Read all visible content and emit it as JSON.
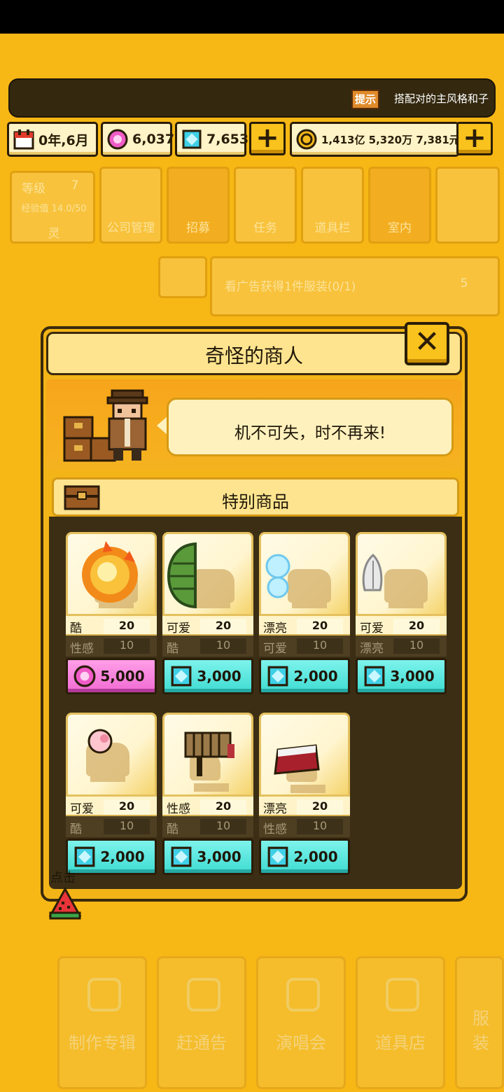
{
  "hint": {
    "badge": "提示",
    "text": "搭配对的主风格和子"
  },
  "resources": {
    "date": "0年,6月",
    "pink_gems": "6,037",
    "blue_gems": "7,653",
    "money": "1,413亿 5,320万 7,381元"
  },
  "background": {
    "level_label": "等级",
    "level_value": "7",
    "exp_label": "经验值 14.0/50",
    "char_name": "灵",
    "menu": [
      "公司管理",
      "招募",
      "任务",
      "道具栏",
      "室内"
    ],
    "ad_text": "看广告获得1件服装(0/1)",
    "ad_reward": "5",
    "bottom_nav": [
      "制作专辑",
      "赶通告",
      "演唱会",
      "道具店",
      "服装"
    ]
  },
  "dialog": {
    "title": "奇怪的商人",
    "close_label": "✕",
    "speech": "机不可失，时不再来!",
    "section_title": "特别商品",
    "items": [
      {
        "stat1_name": "酷",
        "stat1_val": "20",
        "stat2_name": "性感",
        "stat2_val": "10",
        "price": "5,000",
        "currency": "pink"
      },
      {
        "stat1_name": "可爱",
        "stat1_val": "20",
        "stat2_name": "酷",
        "stat2_val": "10",
        "price": "3,000",
        "currency": "blue"
      },
      {
        "stat1_name": "漂亮",
        "stat1_val": "20",
        "stat2_name": "可爱",
        "stat2_val": "10",
        "price": "2,000",
        "currency": "blue"
      },
      {
        "stat1_name": "可爱",
        "stat1_val": "20",
        "stat2_name": "漂亮",
        "stat2_val": "10",
        "price": "3,000",
        "currency": "blue"
      },
      {
        "stat1_name": "可爱",
        "stat1_val": "20",
        "stat2_name": "酷",
        "stat2_val": "10",
        "price": "2,000",
        "currency": "blue"
      },
      {
        "stat1_name": "性感",
        "stat1_val": "20",
        "stat2_name": "酷",
        "stat2_val": "10",
        "price": "3,000",
        "currency": "blue"
      },
      {
        "stat1_name": "漂亮",
        "stat1_val": "20",
        "stat2_name": "性感",
        "stat2_val": "10",
        "price": "2,000",
        "currency": "blue"
      }
    ]
  },
  "tap_hint": "点击",
  "colors": {
    "accent": "#f7b715",
    "dark": "#2a1d08",
    "cyan_button": "#3fdcd2",
    "pink_button": "#f06bd3"
  }
}
